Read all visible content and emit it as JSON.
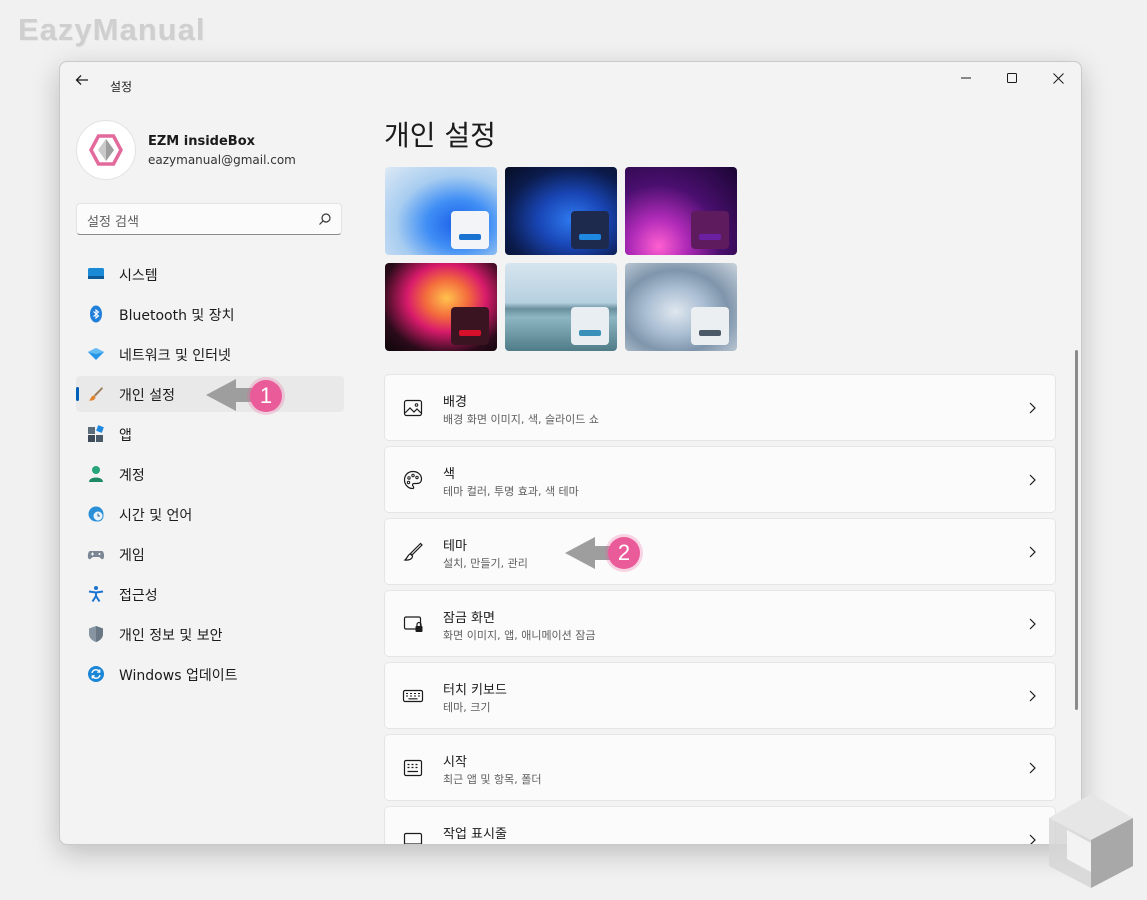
{
  "watermark": "EazyManual",
  "window": {
    "title": "설정",
    "controls": {
      "minimize": "—",
      "maximize": "☐",
      "close": "✕"
    }
  },
  "profile": {
    "name": "EZM insideBox",
    "email": "eazymanual@gmail.com"
  },
  "search": {
    "placeholder": "설정 검색"
  },
  "sidebar": {
    "items": [
      {
        "label": "시스템",
        "icon": "monitor-icon"
      },
      {
        "label": "Bluetooth 및 장치",
        "icon": "bluetooth-icon"
      },
      {
        "label": "네트워크 및 인터넷",
        "icon": "wifi-diamond-icon"
      },
      {
        "label": "개인 설정",
        "icon": "paintbrush-icon",
        "selected": true
      },
      {
        "label": "앱",
        "icon": "apps-icon"
      },
      {
        "label": "계정",
        "icon": "person-icon"
      },
      {
        "label": "시간 및 언어",
        "icon": "globe-clock-icon"
      },
      {
        "label": "게임",
        "icon": "gamepad-icon"
      },
      {
        "label": "접근성",
        "icon": "accessibility-icon"
      },
      {
        "label": "개인 정보 및 보안",
        "icon": "shield-icon"
      },
      {
        "label": "Windows 업데이트",
        "icon": "update-icon"
      }
    ]
  },
  "main": {
    "title": "개인 설정",
    "cards": [
      {
        "title": "배경",
        "subtitle": "배경 화면 이미지, 색, 슬라이드 쇼",
        "icon": "image-icon"
      },
      {
        "title": "색",
        "subtitle": "테마 컬러, 투명 효과, 색 테마",
        "icon": "palette-icon"
      },
      {
        "title": "테마",
        "subtitle": "설치, 만들기, 관리",
        "icon": "brush-icon"
      },
      {
        "title": "잠금 화면",
        "subtitle": "화면 이미지, 앱, 애니메이션 잠금",
        "icon": "lock-screen-icon"
      },
      {
        "title": "터치 키보드",
        "subtitle": "테마, 크기",
        "icon": "keyboard-icon"
      },
      {
        "title": "시작",
        "subtitle": "최근 앱 및 항목, 폴더",
        "icon": "start-menu-icon"
      },
      {
        "title": "작업 표시줄",
        "subtitle": "",
        "icon": "taskbar-icon"
      }
    ]
  },
  "callouts": {
    "first": "1",
    "second": "2"
  },
  "colors": {
    "accent": "#005fb8",
    "callout": "#ea5b9a"
  }
}
